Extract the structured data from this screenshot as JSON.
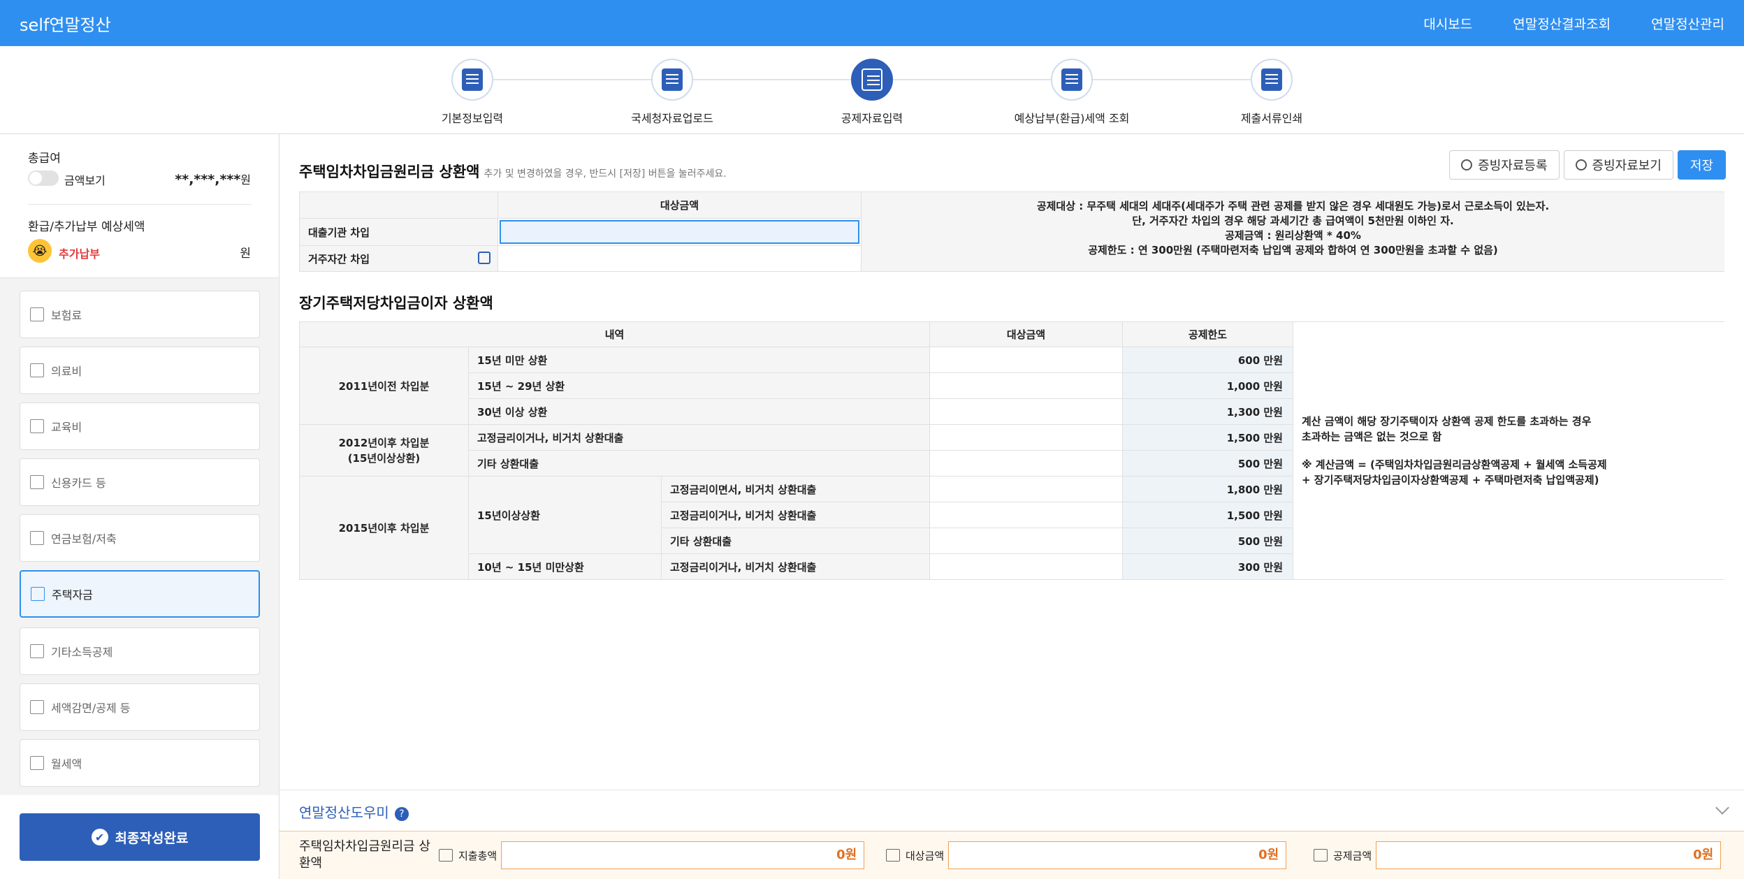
{
  "header": {
    "brand": "self연말정산",
    "nav": [
      "대시보드",
      "연말정산결과조회",
      "연말정산관리"
    ]
  },
  "steps": [
    {
      "label": "기본정보입력",
      "icon": "pencil-doc-icon"
    },
    {
      "label": "국세청자료업로드",
      "icon": "upload-doc-icon"
    },
    {
      "label": "공제자료입력",
      "icon": "calculator-icon"
    },
    {
      "label": "예상납부(환급)세액 조회",
      "icon": "search-doc-icon"
    },
    {
      "label": "제출서류인쇄",
      "icon": "check-doc-icon"
    }
  ],
  "sidebar": {
    "salary_title": "총급여",
    "toggle_label": "금액보기",
    "salary_mask": "**,***,***",
    "won": "원",
    "refund_title": "환급/추가납부 예상세액",
    "refund_status": "추가납부",
    "refund_won": "원",
    "menu": [
      "보험료",
      "의료비",
      "교육비",
      "신용카드 등",
      "연금보험/저축",
      "주택자금",
      "기타소득공제",
      "세액감면/공제 등",
      "월세액"
    ],
    "final_button": "최종작성완료"
  },
  "section1": {
    "title": "주택임차차입금원리금 상환액",
    "hint": "추가 및 변경하였을 경우, 반드시 [저장] 버튼을 눌러주세요.",
    "col_header": "대상금액",
    "rows": [
      "대출기관 차입",
      "거주자간 차입"
    ],
    "info": [
      "공제대상 : 무주택 세대의 세대주(세대주가 주택 관련 공제를 받지 않은 경우 세대원도 가능)로서 근로소득이 있는자.",
      "단, 거주자간 차입의 경우 해당 과세기간 총 급여액이 5천만원 이하인 자.",
      "공제금액 : 원리상환액 * 40%",
      "공제한도 : 연 300만원 (주택마련저축 납입액 공제와 합하여 연 300만원을 초과할 수 없음)"
    ],
    "buttons": {
      "register": "증빙자료등록",
      "view": "증빙자료보기",
      "save": "저장"
    }
  },
  "section2": {
    "title": "장기주택저당차입금이자 상환액",
    "headers": [
      "내역",
      "대상금액",
      "공제한도"
    ],
    "groups": [
      "2011년이전 차입분",
      "2012년이후 차입분\n(15년이상상환)",
      "2015년이후 차입분"
    ],
    "subgroups": [
      "15년이상상환",
      "10년 ~ 15년 미만상환"
    ],
    "items": [
      {
        "label": "15년 미만 상환",
        "limit": "600 만원"
      },
      {
        "label": "15년 ~ 29년 상환",
        "limit": "1,000 만원"
      },
      {
        "label": "30년 이상 상환",
        "limit": "1,300 만원"
      },
      {
        "label": "고정금리이거나, 비거치 상환대출",
        "limit": "1,500 만원"
      },
      {
        "label": "기타 상환대출",
        "limit": "500 만원"
      },
      {
        "label": "고정금리이면서, 비거치 상환대출",
        "limit": "1,800 만원"
      },
      {
        "label": "고정금리이거나, 비거치 상환대출",
        "limit": "1,500 만원"
      },
      {
        "label": "기타 상환대출",
        "limit": "500 만원"
      },
      {
        "label": "고정금리이거나, 비거치 상환대출",
        "limit": "300 만원"
      }
    ],
    "note1": "계산 금액이 해당 장기주택이자 상환액 공제 한도를 초과하는 경우\n초과하는 금액은 없는 것으로 함",
    "note2": "※ 계산금액 = (주택임차차입금원리금상환액공제 + 월세액 소득공제\n+ 장기주택저당차입금이자상환액공제 + 주택마련저축 납입액공제)"
  },
  "helper": {
    "title": "연말정산도우미",
    "q": "?"
  },
  "summary": {
    "label": "주택임차차입금원리금 상환액",
    "fields": [
      {
        "label": "지출총액",
        "value": "0원"
      },
      {
        "label": "대상금액",
        "value": "0원"
      },
      {
        "label": "공제금액",
        "value": "0원"
      }
    ]
  }
}
